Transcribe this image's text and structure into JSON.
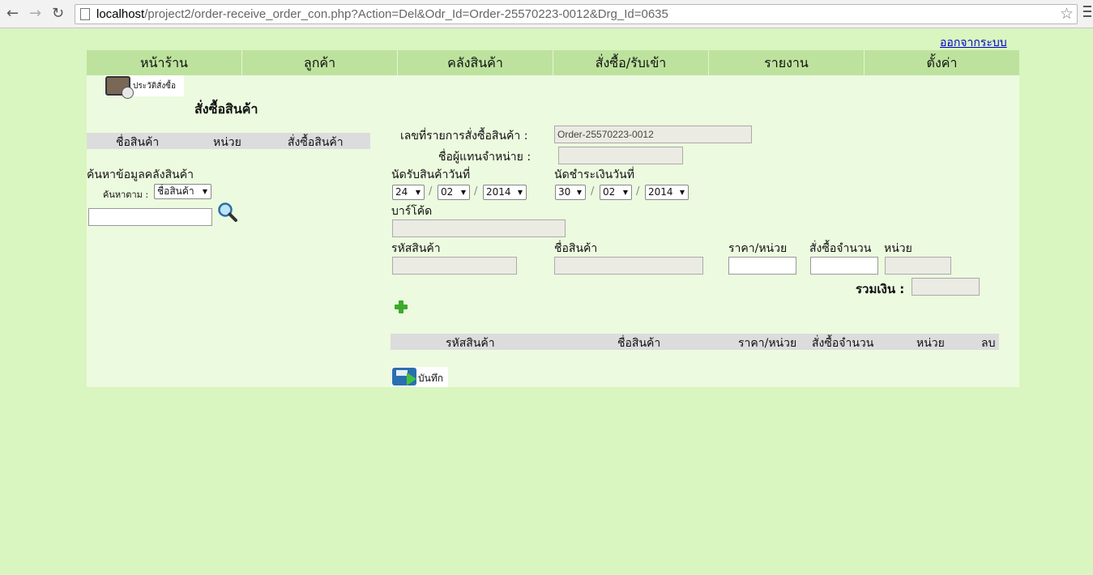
{
  "browser": {
    "url_host": "localhost",
    "url_path": "/project2/order-receive_order_con.php?Action=Del&Odr_Id=Order-25570223-0012&Drg_Id=0635"
  },
  "header": {
    "logout": "ออกจากระบบ"
  },
  "nav": [
    "หน้าร้าน",
    "ลูกค้า",
    "คลังสินค้า",
    "สั่งซื้อ/รับเข้า",
    "รายงาน",
    "ตั้งค่า"
  ],
  "history_button": "ประวัติสั่งซื้อ",
  "page_title": "สั่งซื้อสินค้า",
  "left_table": {
    "headers": [
      "ชื่อสินค้า",
      "หน่วย",
      "สั่งซื้อสินค้า"
    ]
  },
  "search": {
    "title": "ค้นหาข้อมูลคลังสินค้า",
    "by_label": "ค้นหาตาม :",
    "by_value": "ชื่อสินค้า",
    "query": ""
  },
  "form": {
    "order_no_label": "เลขที่รายการสั่งซื้อสินค้า :",
    "order_no_value": "Order-25570223-0012",
    "dealer_label": "ชื่อผู้แทนจำหน่าย :",
    "dealer_value": "",
    "receive_date_label": "นัดรับสินค้าวันที่",
    "receive_day": "24",
    "receive_month": "02",
    "receive_year": "2014",
    "pay_date_label": "นัดชำระเงินวันที่",
    "pay_day": "30",
    "pay_month": "02",
    "pay_year": "2014",
    "date_sep": "/",
    "barcode_label": "บาร์โค้ด",
    "code_label": "รหัสสินค้า",
    "name_label": "ชื่อสินค้า",
    "price_label": "ราคา/หน่วย",
    "qty_label": "สั่งซื้อจำนวน",
    "unit_label": "หน่วย",
    "total_label": "รวมเงิน :"
  },
  "order_table": {
    "headers": [
      "รหัสสินค้า",
      "ชื่อสินค้า",
      "ราคา/หน่วย",
      "สั่งซื้อจำนวน",
      "หน่วย",
      "ลบ"
    ]
  },
  "save_button": "บันทึก"
}
